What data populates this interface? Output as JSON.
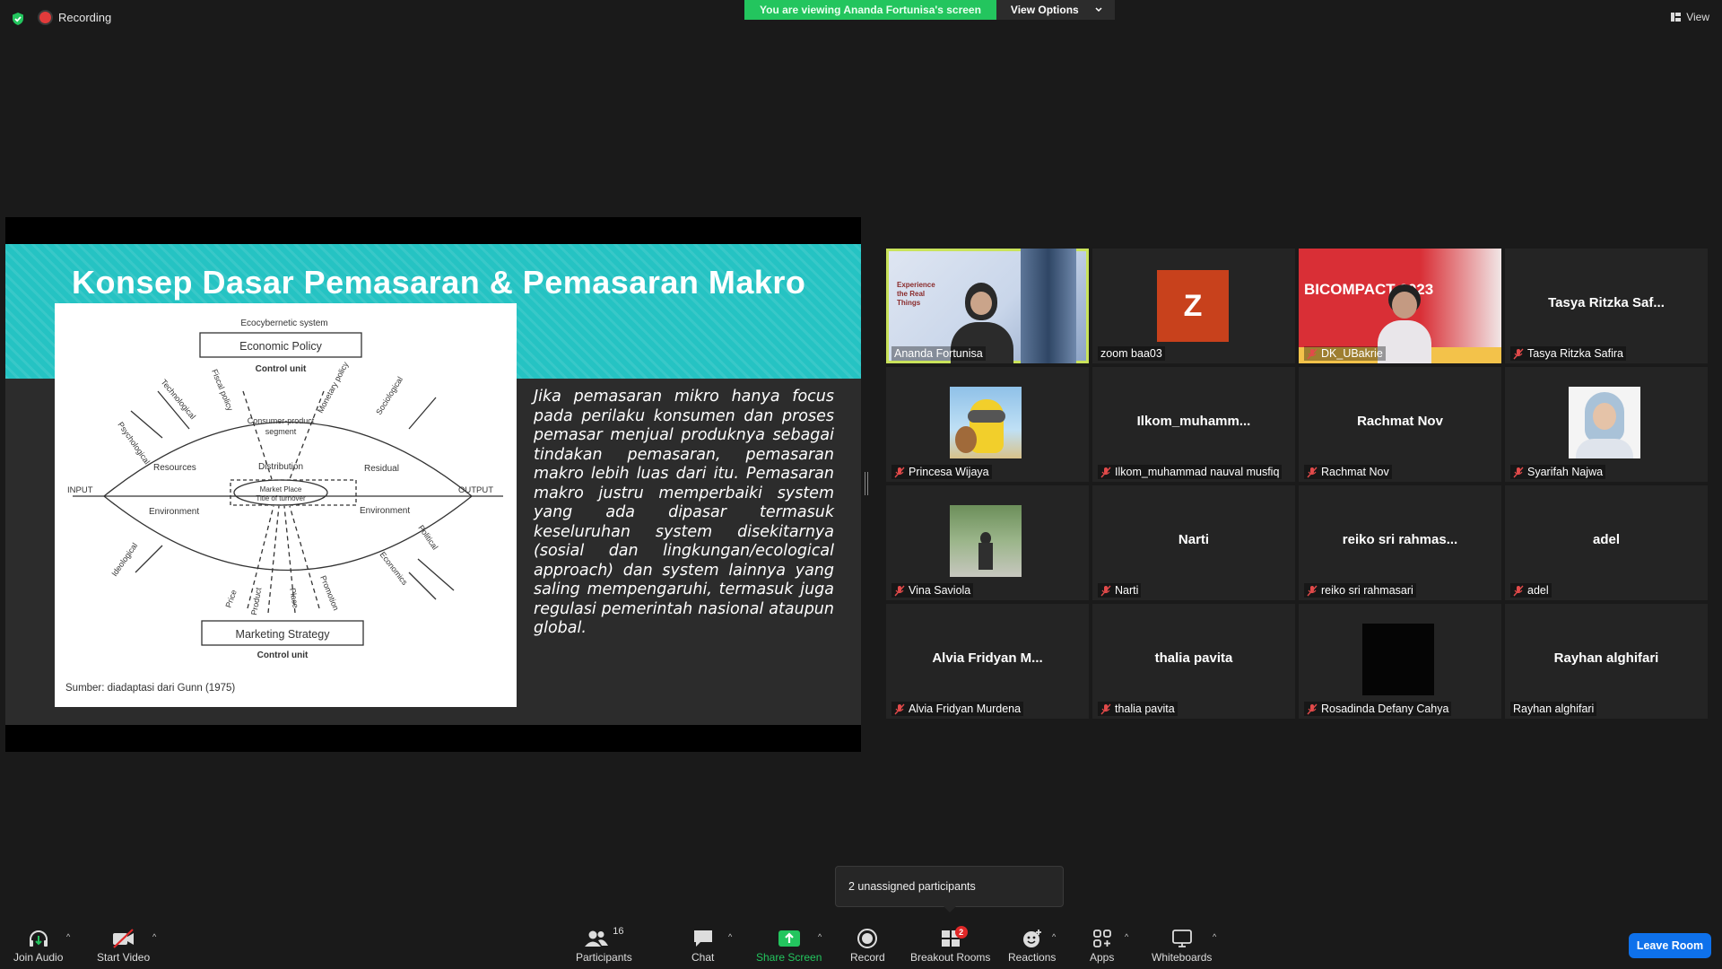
{
  "topbar": {
    "recording_label": "Recording",
    "viewing_banner": "You are viewing Ananda Fortunisa's screen",
    "view_options_label": "View Options",
    "view_label": "View"
  },
  "slide": {
    "title": "Konsep Dasar Pemasaran & Pemasaran Makro",
    "body": "Jika pemasaran mikro hanya focus pada perilaku konsumen dan proses pemasar menjual produknya sebagai tindakan pemasaran, pemasaran makro lebih luas dari itu. Pemasaran makro justru memperbaiki system yang ada dipasar termasuk keseluruhan system disekitarnya (sosial dan lingkungan/ecological approach) dan system lainnya yang saling mempengaruhi, termasuk juga regulasi pemerintah nasional ataupun global.",
    "diagram": {
      "top_caption": "Ecocybernetic system",
      "top_box": "Economic Policy",
      "top_control": "Control unit",
      "bottom_box": "Marketing Strategy",
      "bottom_control": "Control unit",
      "source": "Sumber: diadaptasi dari Gunn (1975)",
      "input": "INPUT",
      "output": "OUTPUT",
      "resources": "Resources",
      "residual": "Residual",
      "distribution": "Distribution",
      "environment_left": "Environment",
      "environment_right": "Environment",
      "consumer_segment_1": "Consumer-product",
      "consumer_segment_2": "segment",
      "market_place": "Market Place",
      "title_turnover": "Title of turnover",
      "forces": {
        "psychological": "Psychological",
        "technological": "Technological",
        "fiscal": "Fiscal policy",
        "monetary": "Monetary policy",
        "sociological": "Sociological",
        "ideological": "Ideological",
        "political": "Political",
        "economics": "Economics",
        "price": "Price",
        "product": "Product",
        "place": "Place",
        "promotion": "Promotion"
      }
    }
  },
  "participants": [
    {
      "name": "Ananda Fortunisa",
      "center": "",
      "muted": false,
      "active": true,
      "type": "video"
    },
    {
      "name": "zoom baa03",
      "center": "",
      "muted": false,
      "type": "avatar",
      "avatar_letter": "Z"
    },
    {
      "name": "DK_UBakrie",
      "center": "",
      "muted": true,
      "type": "video"
    },
    {
      "name": "Tasya Ritzka Safira",
      "center": "Tasya Ritzka Saf...",
      "muted": true,
      "type": "name"
    },
    {
      "name": "Princesa Wijaya",
      "center": "",
      "muted": true,
      "type": "photo"
    },
    {
      "name": "Ilkom_muhammad nauval musfiq",
      "center": "Ilkom_muhamm...",
      "muted": true,
      "type": "name"
    },
    {
      "name": "Rachmat Nov",
      "center": "Rachmat Nov",
      "muted": true,
      "type": "name"
    },
    {
      "name": "Syarifah Najwa",
      "center": "",
      "muted": true,
      "type": "photo"
    },
    {
      "name": "Vina Saviola",
      "center": "",
      "muted": true,
      "type": "photo"
    },
    {
      "name": "Narti",
      "center": "Narti",
      "muted": true,
      "type": "name"
    },
    {
      "name": "reiko sri rahmasari",
      "center": "reiko sri rahmas...",
      "muted": true,
      "type": "name"
    },
    {
      "name": "adel",
      "center": "adel",
      "muted": true,
      "type": "name"
    },
    {
      "name": "Alvia Fridyan Murdena",
      "center": "Alvia Fridyan M...",
      "muted": true,
      "type": "name"
    },
    {
      "name": "thalia pavita",
      "center": "thalia pavita",
      "muted": true,
      "type": "name"
    },
    {
      "name": "Rosadinda Defany Cahya",
      "center": "",
      "muted": true,
      "type": "photo"
    },
    {
      "name": "Rayhan alghifari",
      "center": "Rayhan alghifari",
      "muted": false,
      "type": "name"
    }
  ],
  "tile_overlays": {
    "ananda_bg_text": "Experience the Real Things",
    "bicompact_title": "BICOMPACT 2023"
  },
  "popup": {
    "text": "2 unassigned participants"
  },
  "toolbar": {
    "join_audio": "Join Audio",
    "start_video": "Start Video",
    "participants": "Participants",
    "participants_count": "16",
    "chat": "Chat",
    "share_screen": "Share Screen",
    "record": "Record",
    "breakout_rooms": "Breakout Rooms",
    "breakout_badge": "2",
    "reactions": "Reactions",
    "apps": "Apps",
    "whiteboards": "Whiteboards",
    "leave_room": "Leave Room"
  }
}
